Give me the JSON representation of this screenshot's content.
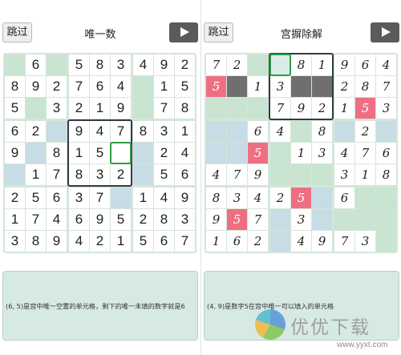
{
  "left": {
    "skip_label": "跳过",
    "title": "唯一数",
    "grid": [
      [
        "",
        "6",
        "",
        "5",
        "8",
        "3",
        "4",
        "9",
        "2"
      ],
      [
        "8",
        "9",
        "2",
        "7",
        "6",
        "4",
        "",
        "1",
        "5"
      ],
      [
        "5",
        "",
        "3",
        "2",
        "1",
        "9",
        "",
        "7",
        "8"
      ],
      [
        "6",
        "2",
        "",
        "9",
        "4",
        "7",
        "8",
        "3",
        "1"
      ],
      [
        "9",
        "",
        "8",
        "1",
        "5",
        "",
        "",
        "2",
        "4"
      ],
      [
        "",
        "1",
        "7",
        "8",
        "3",
        "2",
        "",
        "5",
        "6"
      ],
      [
        "2",
        "5",
        "6",
        "3",
        "7",
        "",
        "1",
        "4",
        "9"
      ],
      [
        "1",
        "7",
        "4",
        "6",
        "9",
        "5",
        "2",
        "8",
        "3"
      ],
      [
        "3",
        "8",
        "9",
        "4",
        "2",
        "1",
        "5",
        "6",
        "7"
      ]
    ],
    "highlight_box": 4,
    "selected_cell": [
      4,
      5
    ],
    "pink_cells": [],
    "gray_cells": [],
    "box_tints": [
      "#c9e4d0",
      "#c9e4d0",
      "#c9e4d0",
      "#c8dce6",
      "#ffffff",
      "#c8dce6",
      "#c8dce6",
      "#c8dce6",
      "#c8dce6"
    ],
    "hint": "(6, 5)是宫中唯一空置的单元格，剩下的唯一未填的数字就是6"
  },
  "right": {
    "skip_label": "跳过",
    "title": "宫摒除解",
    "grid": [
      [
        "7",
        "2",
        "",
        "",
        "8",
        "1",
        "9",
        "6",
        "4"
      ],
      [
        "5",
        "",
        "1",
        "3",
        "",
        "",
        "2",
        "8",
        "7"
      ],
      [
        "",
        "",
        "",
        "7",
        "9",
        "2",
        "1",
        "5",
        "3"
      ],
      [
        "",
        "",
        "6",
        "4",
        "",
        "8",
        "",
        "2",
        ""
      ],
      [
        "",
        "",
        "5",
        "",
        "1",
        "3",
        "4",
        "7",
        "6"
      ],
      [
        "4",
        "7",
        "9",
        "",
        "",
        "",
        "3",
        "1",
        "8"
      ],
      [
        "8",
        "3",
        "4",
        "2",
        "5",
        "",
        "6",
        "",
        ""
      ],
      [
        "9",
        "5",
        "7",
        "",
        "3",
        "",
        "",
        "",
        ""
      ],
      [
        "1",
        "6",
        "2",
        "",
        "4",
        "9",
        "7",
        "3",
        ""
      ]
    ],
    "highlight_box": 1,
    "selected_cell": [
      0,
      3
    ],
    "pink_cells": [
      [
        1,
        0
      ],
      [
        2,
        7
      ],
      [
        4,
        2
      ],
      [
        6,
        4
      ],
      [
        7,
        1
      ]
    ],
    "gray_cells": [
      [
        1,
        1
      ],
      [
        1,
        4
      ],
      [
        1,
        5
      ]
    ],
    "box_tints": [
      "#c9e4d0",
      "#d9ede8",
      "#c8dce6",
      "#c8dce6",
      "#c9e4d0",
      "#c8dce6",
      "#c8dce6",
      "#c8dce6",
      "#c9e4d0"
    ],
    "hint": "(4, 9)是数字5在宫中唯一可以填入的单元格"
  },
  "watermark": {
    "brand": "优优下载",
    "url": "www.yyxt.com"
  },
  "colors": {
    "grid_bg": "#d5e5da",
    "pink": "#ef6f82",
    "gray": "#6f6f6f",
    "highlight": "#343a47",
    "selected": "#2f9b43",
    "hint_bg": "#d7e9e4"
  }
}
